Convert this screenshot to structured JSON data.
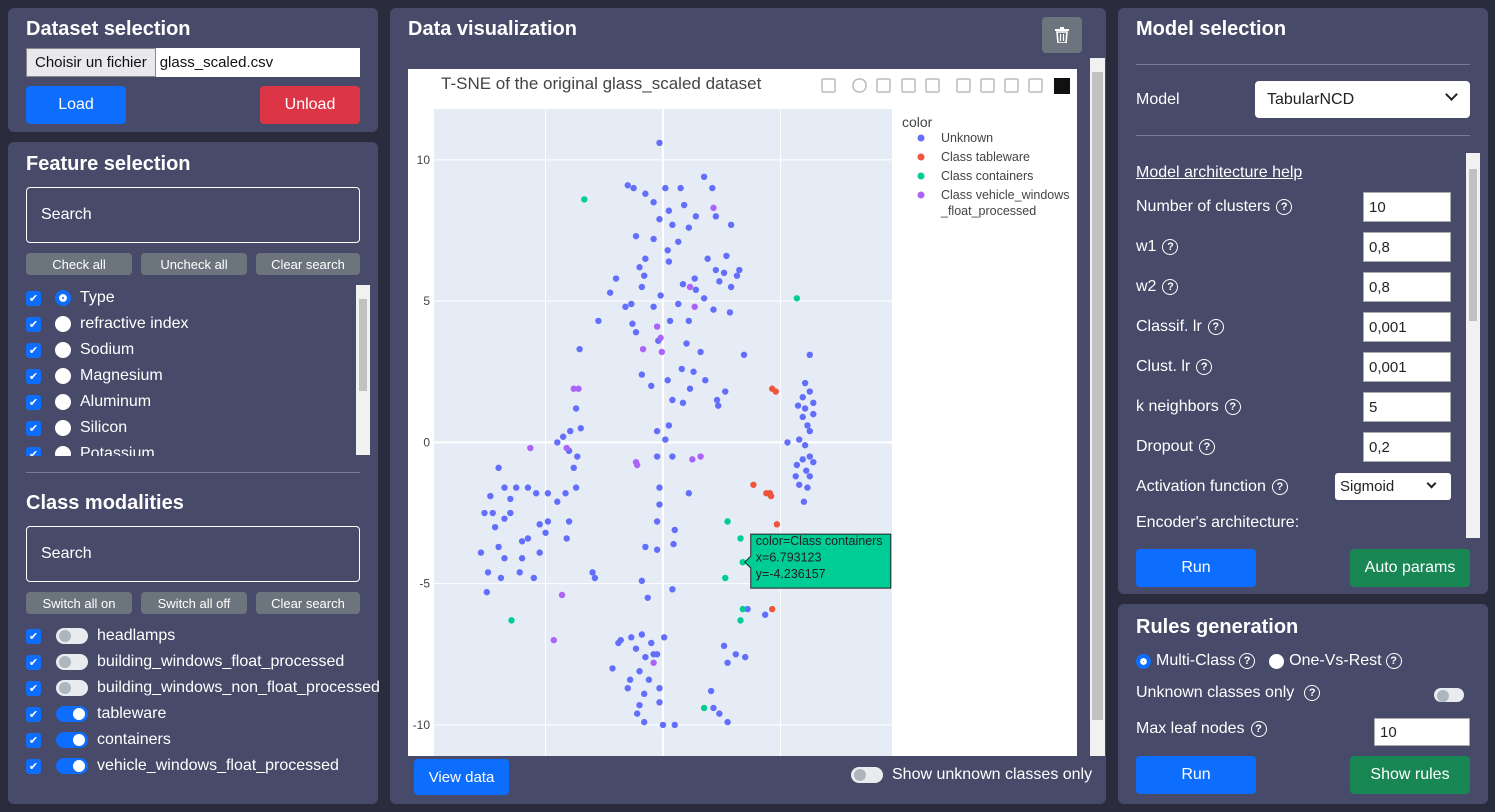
{
  "dataset": {
    "title": "Dataset selection",
    "file_button": "Choisir un fichier",
    "file_name": "glass_scaled.csv",
    "load": "Load",
    "unload": "Unload"
  },
  "features": {
    "title": "Feature selection",
    "search": "Search",
    "check_all": "Check all",
    "uncheck_all": "Uncheck all",
    "clear_search": "Clear search",
    "items": [
      {
        "label": "Type",
        "target": true
      },
      {
        "label": "refractive index",
        "target": false
      },
      {
        "label": "Sodium",
        "target": false
      },
      {
        "label": "Magnesium",
        "target": false
      },
      {
        "label": "Aluminum",
        "target": false
      },
      {
        "label": "Silicon",
        "target": false
      },
      {
        "label": "Potassium",
        "target": false
      }
    ]
  },
  "classes": {
    "title": "Class modalities",
    "search": "Search",
    "switch_on": "Switch all on",
    "switch_off": "Switch all off",
    "clear_search": "Clear search",
    "items": [
      {
        "label": "headlamps",
        "on": false
      },
      {
        "label": "building_windows_float_processed",
        "on": false
      },
      {
        "label": "building_windows_non_float_processed",
        "on": false
      },
      {
        "label": "tableware",
        "on": true
      },
      {
        "label": "containers",
        "on": true
      },
      {
        "label": "vehicle_windows_float_processed",
        "on": true
      }
    ]
  },
  "viz": {
    "title": "Data visualization",
    "view_data": "View data",
    "unknown_only": "Show unknown classes only"
  },
  "chart_data": {
    "type": "scatter",
    "title": "T-SNE of the original glass_scaled dataset",
    "xlabel": "",
    "ylabel": "",
    "xlim": [
      -19.5,
      19.5
    ],
    "ylim": [
      -11.1,
      11.8
    ],
    "yticks": [
      10,
      5,
      0,
      -5,
      -10
    ],
    "xgrid": [
      -10,
      0,
      10
    ],
    "legend_title": "color",
    "series": [
      {
        "name": "Unknown",
        "color": "#636efa",
        "points": [
          [
            -0.3,
            10.6
          ],
          [
            -3,
            9.1
          ],
          [
            -2.5,
            9
          ],
          [
            0.2,
            9
          ],
          [
            1.5,
            9
          ],
          [
            3.5,
            9.4
          ],
          [
            4.2,
            9
          ],
          [
            -1.5,
            8.8
          ],
          [
            -0.8,
            8.5
          ],
          [
            1.8,
            8.4
          ],
          [
            0.5,
            8.2
          ],
          [
            -0.3,
            7.9
          ],
          [
            2.8,
            8
          ],
          [
            4.5,
            8
          ],
          [
            0.8,
            7.7
          ],
          [
            2.2,
            7.6
          ],
          [
            -0.8,
            7.2
          ],
          [
            1.3,
            7.1
          ],
          [
            -2.3,
            7.3
          ],
          [
            5.8,
            7.7
          ],
          [
            -1.5,
            6.5
          ],
          [
            0.4,
            6.8
          ],
          [
            3.8,
            6.5
          ],
          [
            5.4,
            6.6
          ],
          [
            -2,
            6.2
          ],
          [
            0.5,
            6.4
          ],
          [
            6.5,
            6.1
          ],
          [
            -1.6,
            5.9
          ],
          [
            4.5,
            6.1
          ],
          [
            5.2,
            6
          ],
          [
            -4,
            5.8
          ],
          [
            1.7,
            5.6
          ],
          [
            2.7,
            5.8
          ],
          [
            4.8,
            5.7
          ],
          [
            6.3,
            5.9
          ],
          [
            -1.8,
            5.5
          ],
          [
            -0.2,
            5.2
          ],
          [
            2.8,
            5.4
          ],
          [
            -4.5,
            5.3
          ],
          [
            3.5,
            5.1
          ],
          [
            5.8,
            5.5
          ],
          [
            -2.7,
            4.9
          ],
          [
            -3.2,
            4.8
          ],
          [
            -0.8,
            4.8
          ],
          [
            1.3,
            4.9
          ],
          [
            4.3,
            4.7
          ],
          [
            5.7,
            4.6
          ],
          [
            -5.5,
            4.3
          ],
          [
            -2.6,
            4.2
          ],
          [
            0.6,
            4.3
          ],
          [
            2.2,
            4.3
          ],
          [
            -2.3,
            3.9
          ],
          [
            -0.4,
            3.6
          ],
          [
            2,
            3.5
          ],
          [
            -7.1,
            3.3
          ],
          [
            3.2,
            3.2
          ],
          [
            6.9,
            3.1
          ],
          [
            -1.8,
            2.4
          ],
          [
            1.6,
            2.6
          ],
          [
            0.4,
            2.2
          ],
          [
            2.6,
            2.5
          ],
          [
            -1,
            2
          ],
          [
            3.6,
            2.2
          ],
          [
            0.8,
            1.5
          ],
          [
            2.3,
            1.9
          ],
          [
            1.7,
            1.4
          ],
          [
            4.6,
            1.5
          ],
          [
            4.7,
            1.3
          ],
          [
            5.3,
            1.8
          ],
          [
            -7.4,
            1.2
          ],
          [
            0.5,
            0.6
          ],
          [
            -0.5,
            0.4
          ],
          [
            0.2,
            0.1
          ],
          [
            -7,
            0.5
          ],
          [
            -7.9,
            0.4
          ],
          [
            -8.5,
            0.2
          ],
          [
            -9,
            0
          ],
          [
            -8,
            -0.3
          ],
          [
            -7.3,
            -0.5
          ],
          [
            -0.5,
            -0.5
          ],
          [
            0.8,
            -0.5
          ],
          [
            -14,
            -0.9
          ],
          [
            -7.6,
            -0.9
          ],
          [
            -13.5,
            -1.6
          ],
          [
            -12.5,
            -1.6
          ],
          [
            -11.5,
            -1.6
          ],
          [
            -10.8,
            -1.8
          ],
          [
            -9.8,
            -1.8
          ],
          [
            -8.3,
            -1.8
          ],
          [
            -7.4,
            -1.6
          ],
          [
            -14.7,
            -1.9
          ],
          [
            -13,
            -2
          ],
          [
            -9,
            -2.1
          ],
          [
            -0.3,
            -1.6
          ],
          [
            2.2,
            -1.8
          ],
          [
            -15.2,
            -2.5
          ],
          [
            -14.5,
            -2.5
          ],
          [
            -13.5,
            -2.7
          ],
          [
            -13,
            -2.5
          ],
          [
            -10.5,
            -2.9
          ],
          [
            -9.8,
            -2.8
          ],
          [
            -8,
            -2.8
          ],
          [
            -14.3,
            -3
          ],
          [
            -12,
            -3.5
          ],
          [
            -10,
            -3.2
          ],
          [
            -14,
            -3.7
          ],
          [
            -11.5,
            -3.4
          ],
          [
            -8.2,
            -3.4
          ],
          [
            -0.3,
            -2.2
          ],
          [
            -0.5,
            -2.8
          ],
          [
            1,
            -3.1
          ],
          [
            -15.5,
            -3.9
          ],
          [
            -13.5,
            -4.1
          ],
          [
            -12,
            -4.1
          ],
          [
            -10.5,
            -3.9
          ],
          [
            -1.5,
            -3.7
          ],
          [
            -0.5,
            -3.8
          ],
          [
            0.9,
            -3.6
          ],
          [
            -13.8,
            -4.8
          ],
          [
            -14.9,
            -4.6
          ],
          [
            -12.2,
            -4.6
          ],
          [
            -6,
            -4.6
          ],
          [
            -5.8,
            -4.8
          ],
          [
            -11,
            -4.8
          ],
          [
            -15,
            -5.3
          ],
          [
            -1.8,
            -4.9
          ],
          [
            0.8,
            -5.2
          ],
          [
            -1.3,
            -5.5
          ],
          [
            -3.6,
            -7
          ],
          [
            -2.7,
            -6.9
          ],
          [
            -1.8,
            -6.8
          ],
          [
            -1,
            -7.1
          ],
          [
            0.1,
            -6.9
          ],
          [
            -0.8,
            -7.5
          ],
          [
            5.2,
            -7.2
          ],
          [
            -3.8,
            -7.1
          ],
          [
            -2.3,
            -7.3
          ],
          [
            -1.5,
            -7.6
          ],
          [
            -0.5,
            -7.5
          ],
          [
            6.2,
            -7.5
          ],
          [
            7,
            -7.6
          ],
          [
            -4.3,
            -8
          ],
          [
            -2,
            -8.1
          ],
          [
            -1.2,
            -8.4
          ],
          [
            -2.8,
            -8.4
          ],
          [
            5.5,
            -7.8
          ],
          [
            -3,
            -8.7
          ],
          [
            -1.6,
            -8.9
          ],
          [
            -0.3,
            -8.7
          ],
          [
            4.1,
            -8.8
          ],
          [
            -2,
            -9.3
          ],
          [
            -2.2,
            -9.6
          ],
          [
            4.3,
            -9.4
          ],
          [
            4.8,
            -9.6
          ],
          [
            -0.3,
            -9.2
          ],
          [
            -1.6,
            -9.9
          ],
          [
            0,
            -10
          ],
          [
            1,
            -10
          ],
          [
            5.5,
            -9.9
          ],
          [
            7.2,
            -5.9
          ],
          [
            8.7,
            -6.1
          ],
          [
            10.6,
            0
          ],
          [
            12.5,
            3.1
          ],
          [
            12.1,
            2.1
          ],
          [
            12.5,
            1.8
          ],
          [
            11.9,
            1.6
          ],
          [
            12.8,
            1.4
          ],
          [
            11.5,
            1.3
          ],
          [
            12.1,
            1.2
          ],
          [
            12.8,
            1
          ],
          [
            11.9,
            0.9
          ],
          [
            12.3,
            0.6
          ],
          [
            12.5,
            0.4
          ],
          [
            11.6,
            0.1
          ],
          [
            12.1,
            -0.1
          ],
          [
            11.9,
            -0.6
          ],
          [
            12.5,
            -0.5
          ],
          [
            12.8,
            -0.7
          ],
          [
            11.4,
            -0.8
          ],
          [
            12.2,
            -1
          ],
          [
            12.5,
            -1.2
          ],
          [
            11.3,
            -1.2
          ],
          [
            12.3,
            -1.6
          ],
          [
            11.6,
            -1.5
          ],
          [
            12,
            -2.1
          ]
        ]
      },
      {
        "name": "Class tableware",
        "color": "#ef553b",
        "points": [
          [
            9.3,
            1.9
          ],
          [
            9.6,
            1.8
          ],
          [
            7.7,
            -1.5
          ],
          [
            8.8,
            -1.8
          ],
          [
            9.1,
            -1.8
          ],
          [
            9.2,
            -1.9
          ],
          [
            9.7,
            -2.9
          ],
          [
            9.3,
            -5.9
          ]
        ]
      },
      {
        "name": "Class containers",
        "color": "#00cc96",
        "points": [
          [
            -6.7,
            8.6
          ],
          [
            11.4,
            5.1
          ],
          [
            5.5,
            -2.8
          ],
          [
            6.6,
            -3.4
          ],
          [
            6.79,
            -4.24
          ],
          [
            5.3,
            -4.8
          ],
          [
            6.8,
            -5.9
          ],
          [
            6.6,
            -6.3
          ],
          [
            -12.9,
            -6.3
          ],
          [
            3.5,
            -9.4
          ]
        ]
      },
      {
        "name": "Class vehicle_windows_float_processed",
        "color": "#ab63fa",
        "points": [
          [
            4.3,
            8.3
          ],
          [
            2.3,
            5.5
          ],
          [
            2.7,
            4.8
          ],
          [
            -0.5,
            4.1
          ],
          [
            -0.2,
            3.7
          ],
          [
            -7.6,
            1.9
          ],
          [
            -7.2,
            1.9
          ],
          [
            -0.1,
            3.2
          ],
          [
            -1.7,
            3.3
          ],
          [
            -11.3,
            -0.2
          ],
          [
            -8.2,
            -0.2
          ],
          [
            -2.3,
            -0.7
          ],
          [
            -2.2,
            -0.8
          ],
          [
            2.5,
            -0.6
          ],
          [
            3.2,
            -0.5
          ],
          [
            -8.6,
            -5.4
          ],
          [
            -9.3,
            -7
          ],
          [
            -0.8,
            -7.8
          ]
        ]
      }
    ],
    "hover": {
      "color": "color=Class containers",
      "x": "x=6.793123",
      "y": "y=-4.236157"
    }
  },
  "model": {
    "title": "Model selection",
    "model_label": "Model",
    "model_value": "TabularNCD",
    "help": "Model architecture help",
    "params": [
      {
        "label": "Number of clusters",
        "value": "10"
      },
      {
        "label": "w1",
        "value": "0,8"
      },
      {
        "label": "w2",
        "value": "0,8"
      },
      {
        "label": "Classif. lr",
        "value": "0,001"
      },
      {
        "label": "Clust. lr",
        "value": "0,001"
      },
      {
        "label": "k neighbors",
        "value": "5"
      },
      {
        "label": "Dropout",
        "value": "0,2"
      }
    ],
    "activation_label": "Activation function",
    "activation_value": "Sigmoid",
    "encoder_label": "Encoder's architecture:",
    "run": "Run",
    "auto": "Auto params"
  },
  "rules": {
    "title": "Rules generation",
    "multi": "Multi-Class",
    "ovr": "One-Vs-Rest",
    "unknown_only": "Unknown classes only",
    "max_leaf": "Max leaf nodes",
    "max_leaf_value": "10",
    "run": "Run",
    "show": "Show rules"
  },
  "help_glyph": "?"
}
